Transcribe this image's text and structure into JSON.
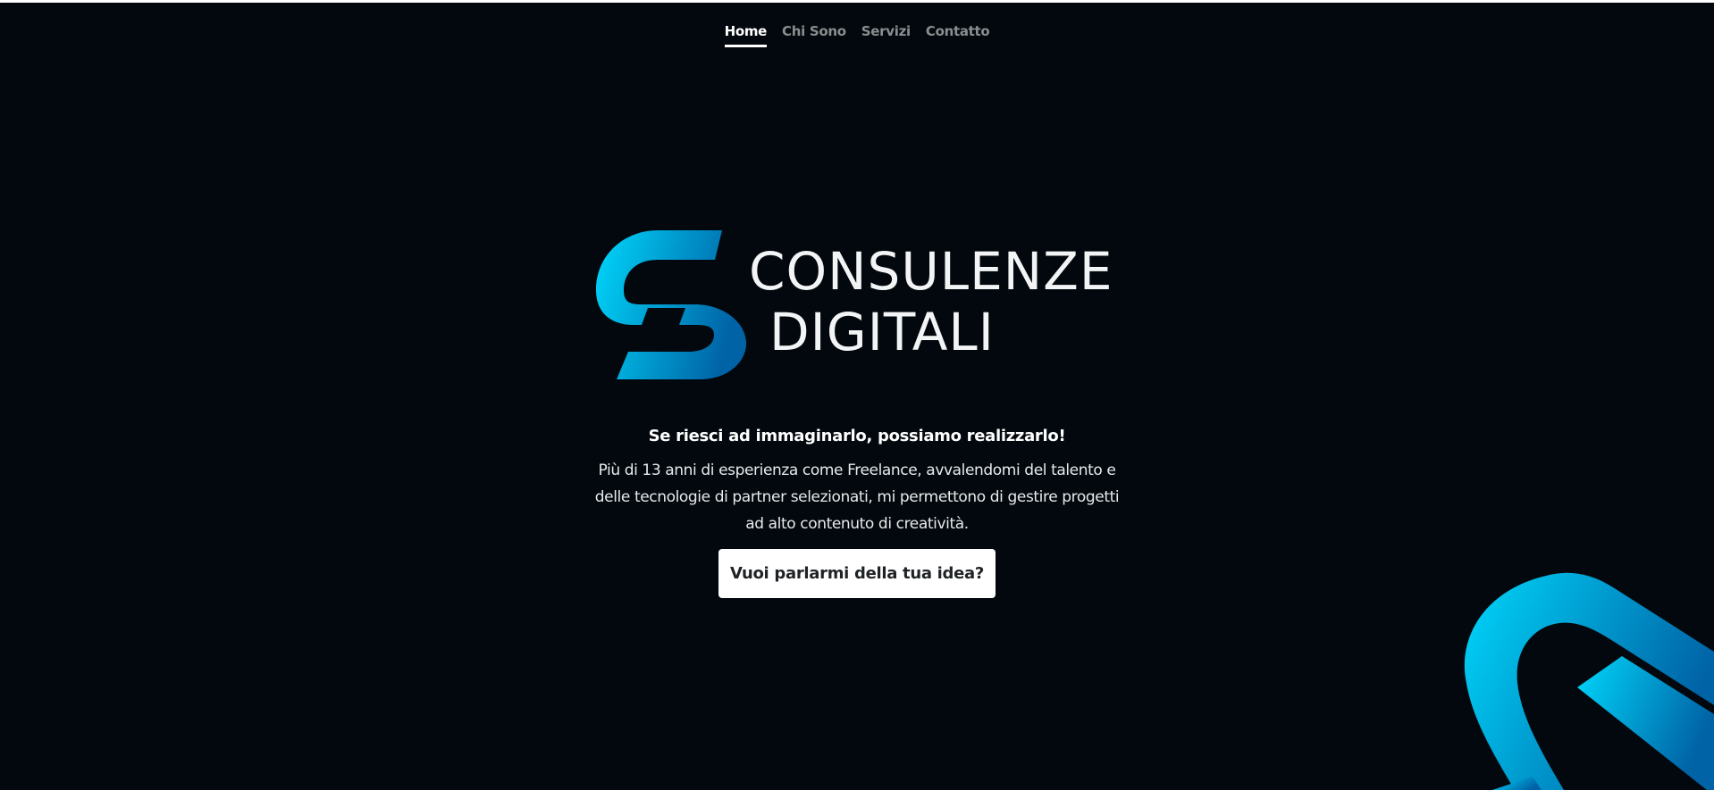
{
  "nav": {
    "items": [
      {
        "label": "Home"
      },
      {
        "label": "Chi Sono"
      },
      {
        "label": "Servizi"
      },
      {
        "label": "Contatto"
      }
    ],
    "active": "Home"
  },
  "logo": {
    "line1": "CONSULENZE",
    "line2": "DIGITALI",
    "icon": "cd-monogram-icon"
  },
  "hero": {
    "tagline": "Se riesci ad immaginarlo, possiamo realizzarlo!",
    "description": "Più di 13 anni di esperienza come Freelance, avvalendomi del talento e delle tecnologie di partner selezionati, mi permettono di gestire progetti ad alto contenuto di creatività.",
    "cta_label": "Vuoi parlarmi della tua idea?"
  },
  "colors": {
    "background": "#02080d",
    "accent_light": "#00d7fb",
    "accent_dark": "#0063a6",
    "text": "#ffffff",
    "nav_inactive": "#8b8e91"
  }
}
